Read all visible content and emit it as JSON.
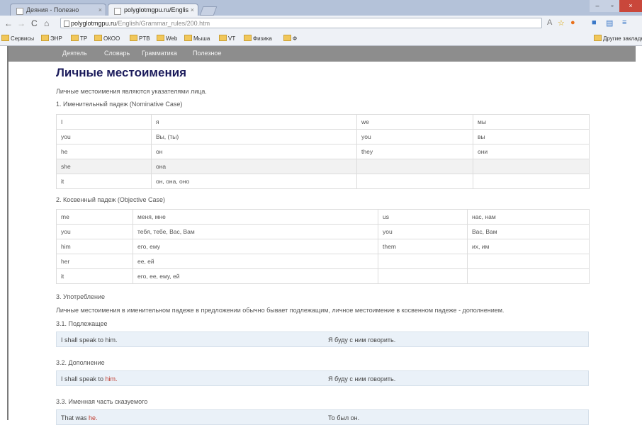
{
  "browser": {
    "tabs": [
      {
        "label": "Деяния - Полезно",
        "active": false
      },
      {
        "label": "polyglotmgpu.ru/Englis",
        "active": true
      }
    ],
    "address": {
      "host": "polyglotmgpu.ru",
      "path": "/English/Grammar_rules/200.htm"
    },
    "bookmarks": [
      "Сервисы",
      "ЭНР",
      "ТР",
      "ОКОО",
      "PTB",
      "Web",
      "Мыша",
      "VT",
      "Физика",
      "Ф"
    ],
    "bookmarks_right": "Другие закладки"
  },
  "site_nav": [
    "Деятель",
    "Словарь",
    "Грамматика",
    "Полезное"
  ],
  "page": {
    "title": "Личные местоимения",
    "intro": "Личные местоимения являются указателями лица.",
    "section1": "1. Именительный падеж (Nominative Case)",
    "table1": [
      [
        "I",
        "я",
        "we",
        "мы"
      ],
      [
        "you",
        "Вы, (ты)",
        "you",
        "вы"
      ],
      [
        "he",
        "он",
        "they",
        "они"
      ],
      [
        "she",
        "она",
        "",
        ""
      ],
      [
        "it",
        "он, она, оно",
        "",
        ""
      ]
    ],
    "section2": "2. Косвенный падеж (Objective Case)",
    "table2": [
      [
        "me",
        "меня, мне",
        "us",
        "нас, нам"
      ],
      [
        "you",
        "тебя, тебе, Вас, Вам",
        "you",
        "Вас, Вам"
      ],
      [
        "him",
        "его, ему",
        "them",
        "их, им"
      ],
      [
        "her",
        "ее, ей",
        "",
        ""
      ],
      [
        "it",
        "его, ее, ему, ей",
        "",
        ""
      ]
    ],
    "section3": "3. Употребление",
    "usage": "Личные местоимения в именительном падеже в предложении обычно бывает подлежащим, личное местоимение в косвенном падеже - дополнением.",
    "sub1": "3.1. Подлежащее",
    "ex1": {
      "en_pre": "I shall speak to him.",
      "en_hl": "",
      "ru": "Я буду с ним говорить."
    },
    "sub2": "3.2. Дополнение",
    "ex2": {
      "en_pre": "I shall speak to ",
      "en_hl": "him.",
      "ru": "Я буду с ним говорить."
    },
    "sub3": "3.3. Именная часть сказуемого",
    "ex3": {
      "en_pre": "That was ",
      "en_hl": "he.",
      "ru": "То был он."
    }
  },
  "colors": {
    "title": "#1c1c5c",
    "nav": "#8d8d8d",
    "example_bg": "#eaf1f8",
    "highlight": "#c0392b"
  }
}
